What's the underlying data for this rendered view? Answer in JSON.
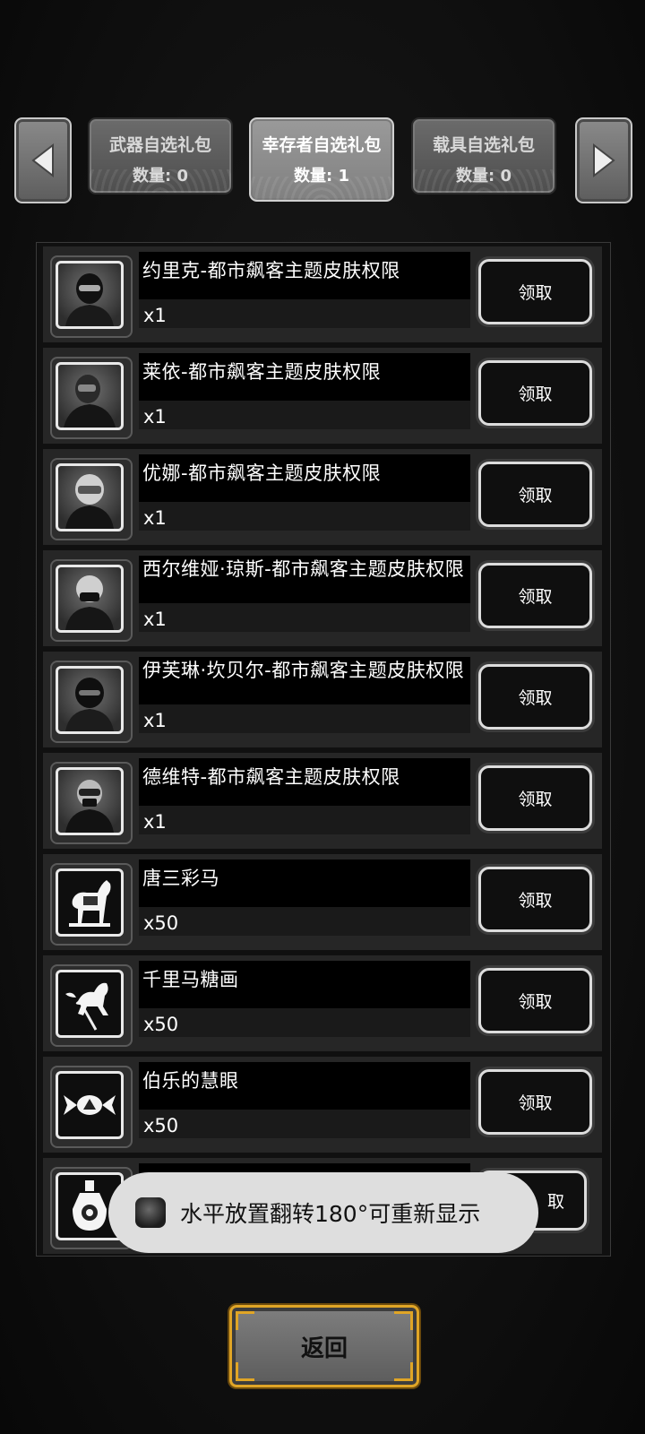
{
  "tabs": [
    {
      "name": "武器自选礼包",
      "count": "数量: 0"
    },
    {
      "name": "幸存者自选礼包",
      "count": "数量: 1"
    },
    {
      "name": "载具自选礼包",
      "count": "数量: 0"
    }
  ],
  "active_tab": 1,
  "items": [
    {
      "name": "约里克-都市飙客主题皮肤权限",
      "qty": "x1",
      "icon": "helmet-rider-icon"
    },
    {
      "name": "莱依-都市飙客主题皮肤权限",
      "qty": "x1",
      "icon": "helmet-rider-icon"
    },
    {
      "name": "优娜-都市飙客主题皮肤权限",
      "qty": "x1",
      "icon": "helmet-rider-icon"
    },
    {
      "name": "西尔维娅·琼斯-都市飙客主题皮肤权限",
      "qty": "x1",
      "icon": "helmet-rider-icon"
    },
    {
      "name": "伊芙琳·坎贝尔-都市飙客主题皮肤权限",
      "qty": "x1",
      "icon": "helmet-rider-icon"
    },
    {
      "name": "德维特-都市飙客主题皮肤权限",
      "qty": "x1",
      "icon": "helmet-rider-icon"
    },
    {
      "name": "唐三彩马",
      "qty": "x50",
      "icon": "tang-horse-icon"
    },
    {
      "name": "千里马糖画",
      "qty": "x50",
      "icon": "sugar-horse-icon"
    },
    {
      "name": "伯乐的慧眼",
      "qty": "x50",
      "icon": "candy-icon"
    },
    {
      "name": "",
      "qty": "",
      "icon": "bottle-icon"
    }
  ],
  "claim_label": "领取",
  "claim_label_partial": "取",
  "toast": {
    "text": "水平放置翻转180°可重新显示"
  },
  "back_label": "返回",
  "colors": {
    "accent_gold": "#e0a526",
    "toast_bg": "#dedede"
  }
}
